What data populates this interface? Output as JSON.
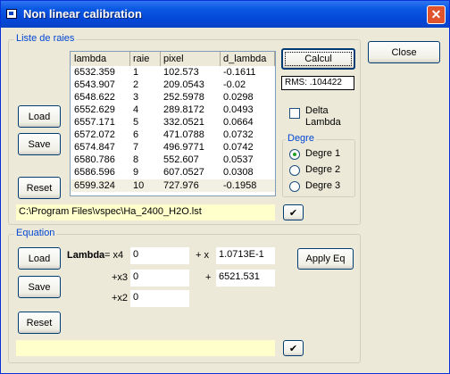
{
  "window": {
    "title": "Non linear calibration",
    "close_glyph": "✕"
  },
  "close_button": "Close",
  "liste": {
    "group_label": "Liste de raies",
    "columns": [
      "lambda",
      "raie",
      "pixel",
      "d_lambda"
    ],
    "rows": [
      [
        "6532.359",
        "1",
        "102.573",
        "-0.1611"
      ],
      [
        "6543.907",
        "2",
        "209.0543",
        "-0.02"
      ],
      [
        "6548.622",
        "3",
        "252.5978",
        "0.0298"
      ],
      [
        "6552.629",
        "4",
        "289.8172",
        "0.0493"
      ],
      [
        "6557.171",
        "5",
        "332.0521",
        "0.0664"
      ],
      [
        "6572.072",
        "6",
        "471.0788",
        "0.0732"
      ],
      [
        "6574.847",
        "7",
        "496.9771",
        "0.0742"
      ],
      [
        "6580.786",
        "8",
        "552.607",
        "0.0537"
      ],
      [
        "6586.596",
        "9",
        "607.0527",
        "0.0308"
      ],
      [
        "6599.324",
        "10",
        "727.976",
        "-0.1958"
      ]
    ],
    "load": "Load",
    "save": "Save",
    "reset": "Reset",
    "calcul": "Calcul",
    "rms": "RMS:  .104422",
    "delta_lambda": "Delta\nLambda",
    "degre_label": "Degre",
    "degre_options": [
      "Degre 1",
      "Degre 2",
      "Degre 3"
    ],
    "degre_selected": "Degre 1",
    "file_path": "C:\\Program Files\\vspec\\Ha_2400_H2O.lst",
    "ok_glyph": "✔"
  },
  "equation": {
    "group_label": "Equation",
    "load": "Load",
    "save": "Save",
    "reset": "Reset",
    "apply": "Apply Eq",
    "lambda_label": "Lambda",
    "eq_x4": "= x4",
    "eq_x": "+ x",
    "eq_x3": "+x3",
    "eq_plus": "+",
    "eq_x2": "+x2",
    "x4": "0",
    "x": "1.0713E-1",
    "x3": "0",
    "c": "6521.531",
    "x2": "0",
    "bottom_field": "",
    "ok_glyph": "✔"
  }
}
